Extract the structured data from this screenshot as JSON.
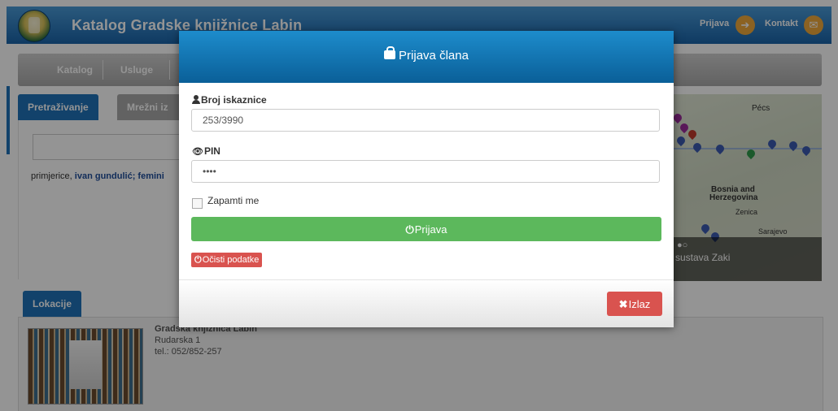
{
  "header": {
    "title": "Katalog Gradske knjižnice Labin",
    "login_link": "Prijava",
    "contact_link": "Kontakt",
    "login_icon": "login-arrow-icon",
    "contact_icon": "envelope-icon"
  },
  "nav": {
    "items": [
      {
        "label": "Katalog"
      },
      {
        "label": "Usluge"
      }
    ]
  },
  "search": {
    "tabs": [
      {
        "label": "Pretraživanje"
      },
      {
        "label": "Mrežni iz"
      }
    ],
    "example_prefix": "primjerice, ",
    "example_links": "ivan gundulić; femini"
  },
  "map": {
    "labels": {
      "country1": "Bosnia and",
      "country2": "Herzegovina",
      "city": "Sarajevo",
      "place1": "Pécs",
      "place2": "Zenica"
    },
    "caption": "sustava Zaki",
    "pin_colors": [
      "#9b2b9b",
      "#3b5bb0",
      "#2f9a4a",
      "#c0392b"
    ]
  },
  "locations": {
    "tab_label": "Lokacije",
    "name": "Gradska knjižnica Labin",
    "address": "Rudarska 1",
    "phone": "tel.: 052/852-257"
  },
  "modal": {
    "title": "Prijava člana",
    "card_label": "Broj iskaznice",
    "card_value": "253/3990",
    "pin_label": "PIN",
    "pin_value": "1234",
    "remember_label": "Zapamti me",
    "login_button": "Prijava",
    "clear_button": "Očisti podatke",
    "exit_button": "Izlaz",
    "colors": {
      "header": "#1d8ccc",
      "success": "#5cb85c",
      "danger": "#d9534f"
    }
  }
}
